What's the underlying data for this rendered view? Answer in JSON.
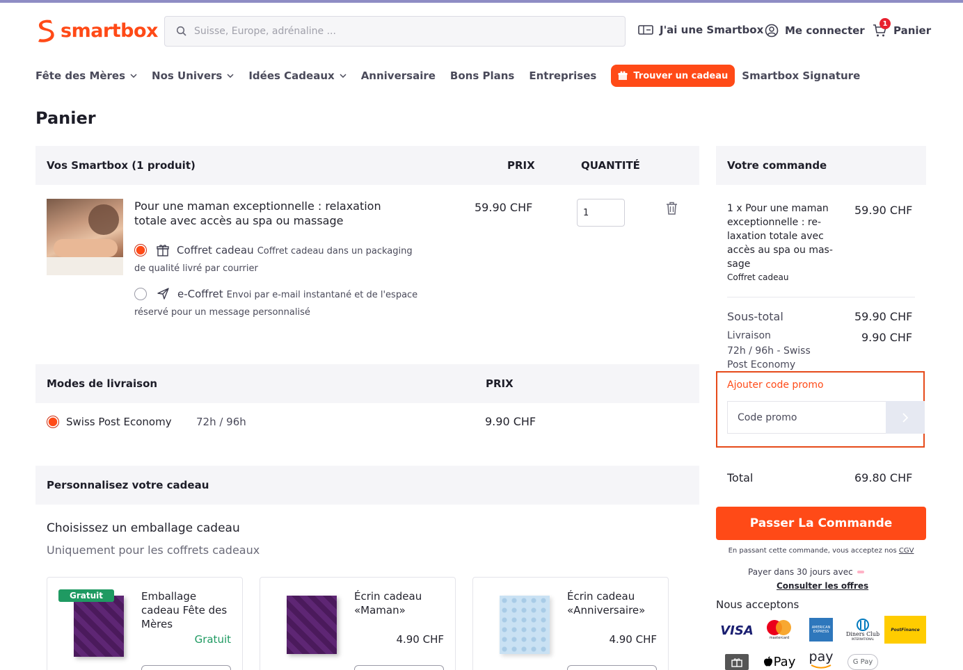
{
  "header": {
    "brand": "smartbox",
    "search_placeholder": "Suisse, Europe, adrénaline ...",
    "have_box": "J'ai une Smartbox",
    "login": "Me connecter",
    "cart": "Panier",
    "cart_count": "1"
  },
  "nav": {
    "items": [
      "Fête des Mères",
      "Nos Univers",
      "Idées Cadeaux",
      "Anniversaire",
      "Bons Plans",
      "Entreprises"
    ],
    "cta": "Trouver un cadeau",
    "signature": "Smartbox Signature"
  },
  "page_title": "Panier",
  "cart": {
    "header_title": "Vos Smartbox (1 produit)",
    "col_price": "PRIX",
    "col_qty": "QUANTITÉ",
    "product_title": "Pour une maman exceptionnelle : relaxation totale avec accès au spa ou massage",
    "product_price": "59.90 CHF",
    "quantity": "1",
    "opt1_name": "Coffret cadeau",
    "opt1_desc_a": "Coffret cadeau dans un packaging",
    "opt1_desc_b": "de qualité livré par courrier",
    "opt2_name": "e-Coffret",
    "opt2_desc_a": "Envoi par e-mail instantané et de l'espace",
    "opt2_desc_b": "réservé pour un message personnalisé"
  },
  "delivery": {
    "header_title": "Modes de livraison",
    "col_price": "PRIX",
    "method": "Swiss Post Economy",
    "delay": "72h / 96h",
    "price": "9.90 CHF"
  },
  "personalize": {
    "header_title": "Personnalisez votre cadeau",
    "subtitle": "Choisissez un emballage cadeau",
    "note": "Uniquement pour les coffrets cadeaux",
    "cards": [
      {
        "tag": "Gratuit",
        "name": "Emballage cadeau Fête des Mères",
        "price": "Gratuit"
      },
      {
        "name": "Écrin cadeau «Maman»",
        "price": "4.90 CHF"
      },
      {
        "name": "Écrin cadeau «Anniversaire»",
        "price": "4.90 CHF"
      }
    ]
  },
  "order": {
    "header_title": "Votre commande",
    "item_lines": [
      "1 x Pour une maman",
      "exceptionnelle : re-",
      "laxation totale avec",
      "accès au spa ou mas-",
      "sage"
    ],
    "item_type": "Coffret cadeau",
    "item_price": "59.90 CHF",
    "subtotal_label": "Sous-total",
    "subtotal": "59.90 CHF",
    "shipping_label": "Livraison",
    "shipping_detail_a": "72h / 96h - Swiss",
    "shipping_detail_b": "Post Economy",
    "shipping": "9.90 CHF",
    "promo_label": "Ajouter code promo",
    "promo_placeholder": "Code promo",
    "total_label": "Total",
    "total": "69.80 CHF",
    "cta": "Passer La Commande",
    "terms_prefix": "En passant cette commande, vous acceptez nos",
    "terms_link": "CGV",
    "klarna_text": "Payer dans 30 jours avec",
    "klarna_brand": "Klarna.",
    "klarna_link": "Consulter les offres",
    "accept_label": "Nous acceptons",
    "payments": {
      "visa": "VISA",
      "mastercard": "mastercard",
      "amex": "AMERICAN EXPRESS",
      "diners_a": "Diners Club",
      "diners_b": "INTERNATIONAL",
      "postfinance": "PostFinance",
      "applepay": "Pay",
      "amazon": "pay",
      "gpay": "G Pay"
    }
  },
  "colors": {
    "accent": "#ff4a17",
    "green": "#1f9a62",
    "panel": "#f5f5f8"
  }
}
